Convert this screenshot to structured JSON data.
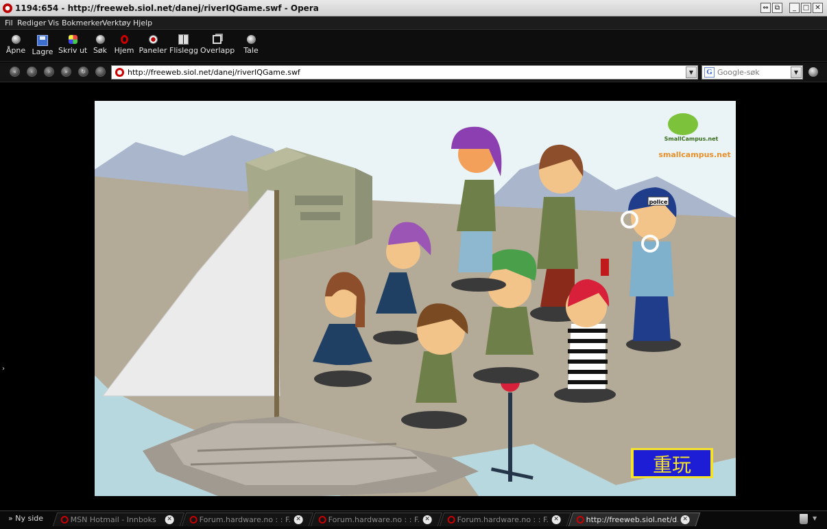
{
  "window": {
    "title": "1194:654 - http://freeweb.siol.net/danej/riverIQGame.swf - Opera",
    "controls": [
      "⇔",
      "⧉",
      "_",
      "□",
      "✕"
    ]
  },
  "menu": [
    "Fil",
    "Rediger",
    "Vis",
    "Bokmerker",
    "Verktøy",
    "Hjelp"
  ],
  "toolbar": [
    {
      "label": "Åpne",
      "icon": "open-icon"
    },
    {
      "label": "Lagre",
      "icon": "save-icon"
    },
    {
      "label": "Skriv ut",
      "icon": "print-icon"
    },
    {
      "label": "Søk",
      "icon": "search-icon"
    },
    {
      "label": "Hjem",
      "icon": "home-icon"
    },
    {
      "label": "Paneler",
      "icon": "panels-icon"
    },
    {
      "label": "Flislegg",
      "icon": "tile-icon"
    },
    {
      "label": "Overlapp",
      "icon": "cascade-icon"
    },
    {
      "label": "Tale",
      "icon": "speech-icon"
    }
  ],
  "address": {
    "url": "http://freeweb.siol.net/danej/riverIQGame.swf",
    "search_placeholder": "Google-søk"
  },
  "game": {
    "logo_text": "smallcampus.net",
    "logo_small": "SmallCampus.net",
    "police_label": "police",
    "replay_label": "重玩",
    "colors": {
      "sky": "#eaf3f6",
      "ground": "#b3aa98",
      "water": "#b8d8df",
      "replay_bg": "#1d1dd6",
      "replay_border": "#f4e32a"
    }
  },
  "tabs": {
    "new_tab": "Ny side",
    "items": [
      {
        "label": "MSN Hotmail - Innboks",
        "active": false
      },
      {
        "label": "Forum.hardware.no : : F...",
        "active": false
      },
      {
        "label": "Forum.hardware.no : : F...",
        "active": false
      },
      {
        "label": "Forum.hardware.no : : F...",
        "active": false
      },
      {
        "label": "http://freeweb.siol.net/d...",
        "active": true
      }
    ]
  }
}
